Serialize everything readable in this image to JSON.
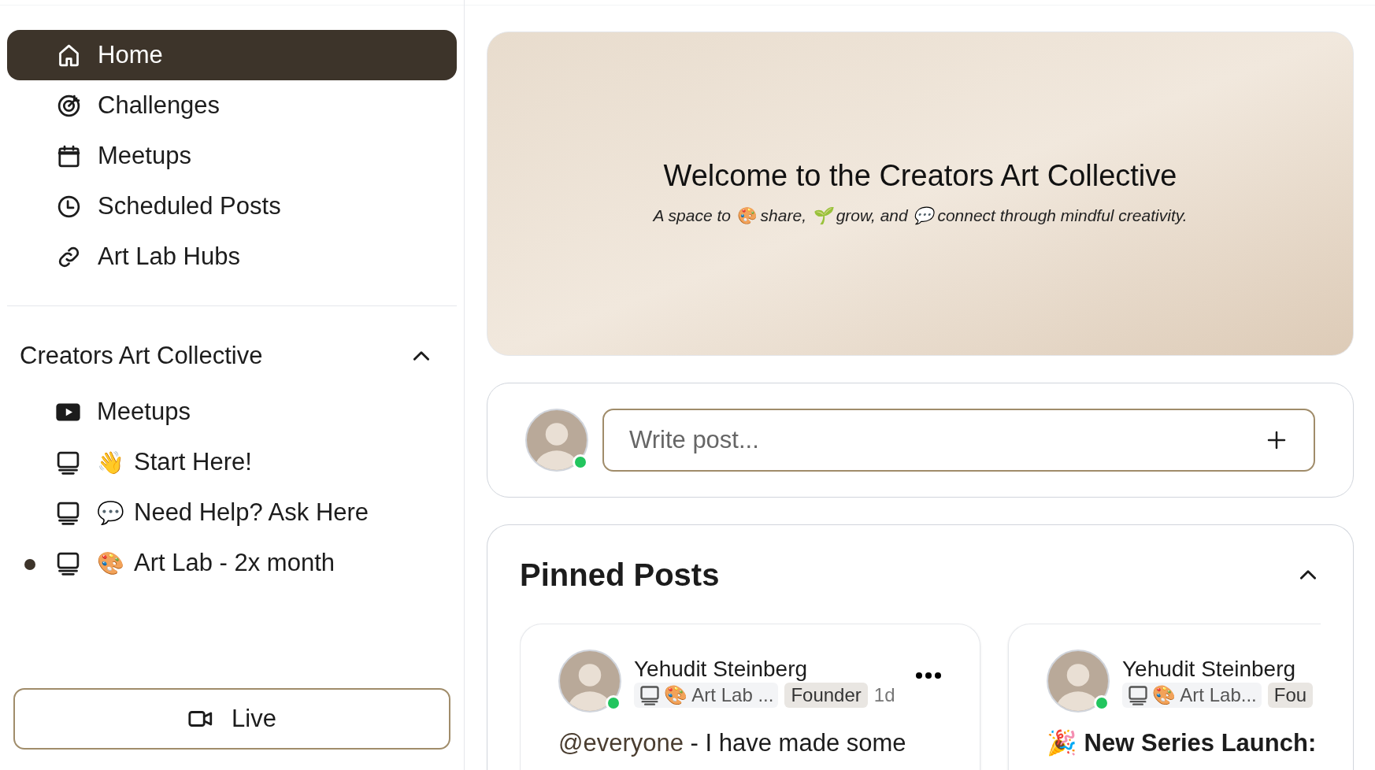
{
  "nav": [
    {
      "label": "Home",
      "selected": true
    },
    {
      "label": "Challenges",
      "selected": false
    },
    {
      "label": "Meetups",
      "selected": false
    },
    {
      "label": "Scheduled Posts",
      "selected": false
    },
    {
      "label": "Art Lab Hubs",
      "selected": false
    }
  ],
  "group": {
    "title": "Creators Art Collective",
    "expanded": true,
    "items": [
      {
        "kind": "meetup",
        "label": "Meetups",
        "unread": false
      },
      {
        "kind": "space",
        "emoji": "👋",
        "label": "Start Here!",
        "unread": false
      },
      {
        "kind": "space",
        "emoji": "💬",
        "label": "Need Help? Ask Here",
        "unread": false
      },
      {
        "kind": "space",
        "emoji": "🎨",
        "label": "Art Lab - 2x month",
        "unread": true
      }
    ]
  },
  "live_button": {
    "label": "Live"
  },
  "banner": {
    "title": "Welcome to the Creators Art Collective",
    "subtitle": "A space to 🎨 share, 🌱 grow, and 💬 connect through mindful creativity."
  },
  "composer": {
    "placeholder": "Write post...",
    "online": true
  },
  "pinned": {
    "title": "Pinned Posts",
    "expanded": true,
    "posts": [
      {
        "author": "Yehudit Steinberg",
        "online": true,
        "space": "🎨 Art Lab ...",
        "role": "Founder",
        "time": "1d",
        "menu": true,
        "kind": "mention",
        "mention": "@everyone",
        "body": "- I have made some"
      },
      {
        "author": "Yehudit Steinberg",
        "online": true,
        "space": "🎨 Art Lab...",
        "role": "Fou",
        "menu": false,
        "kind": "headline",
        "body": "🎉 New Series Launch:"
      }
    ]
  }
}
